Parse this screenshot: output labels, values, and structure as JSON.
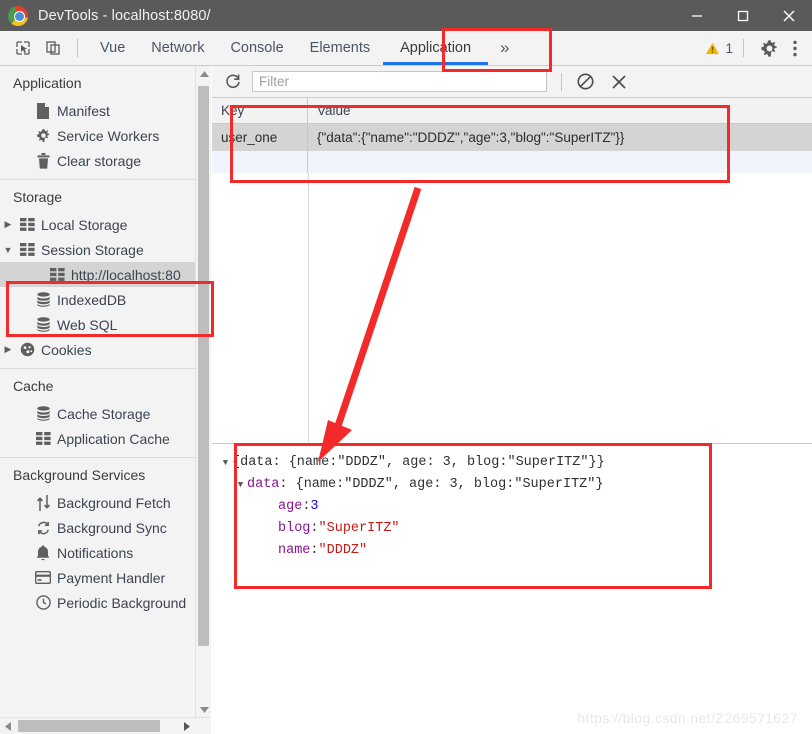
{
  "window": {
    "title": "DevTools - localhost:8080/",
    "logo_icon": "chrome-logo-icon",
    "minimize_label": "minimize-icon",
    "maximize_label": "maximize-icon",
    "close_label": "close-icon"
  },
  "tabbar": {
    "inspect_icon": "inspect-element-icon",
    "device_icon": "device-toolbar-icon",
    "tabs": [
      {
        "label": "Vue",
        "active": false
      },
      {
        "label": "Network",
        "active": false
      },
      {
        "label": "Console",
        "active": false
      },
      {
        "label": "Elements",
        "active": false
      },
      {
        "label": "Application",
        "active": true
      }
    ],
    "more_label": "»",
    "warning_icon": "warning-triangle-icon",
    "warning_count": "1",
    "settings_icon": "gear-icon",
    "menu_icon": "kebab-menu-icon"
  },
  "sidebar": {
    "sections": [
      {
        "title": "Application",
        "items": [
          {
            "label": "Manifest",
            "icon": "document-icon",
            "twisty": "",
            "indent": 1,
            "selected": false
          },
          {
            "label": "Service Workers",
            "icon": "gear-icon",
            "twisty": "",
            "indent": 1,
            "selected": false
          },
          {
            "label": "Clear storage",
            "icon": "trash-icon",
            "twisty": "",
            "indent": 1,
            "selected": false
          }
        ]
      },
      {
        "title": "Storage",
        "items": [
          {
            "label": "Local Storage",
            "icon": "table-grid-icon",
            "twisty": "▶",
            "indent": 0,
            "selected": false
          },
          {
            "label": "Session Storage",
            "icon": "table-grid-icon",
            "twisty": "▼",
            "indent": 0,
            "selected": false
          },
          {
            "label": "http://localhost:80",
            "icon": "table-grid-icon",
            "twisty": "",
            "indent": 2,
            "selected": true
          },
          {
            "label": "IndexedDB",
            "icon": "database-icon",
            "twisty": "",
            "indent": 1,
            "selected": false
          },
          {
            "label": "Web SQL",
            "icon": "database-icon",
            "twisty": "",
            "indent": 1,
            "selected": false
          },
          {
            "label": "Cookies",
            "icon": "cookie-icon",
            "twisty": "▶",
            "indent": 0,
            "selected": false
          }
        ]
      },
      {
        "title": "Cache",
        "items": [
          {
            "label": "Cache Storage",
            "icon": "database-icon",
            "twisty": "",
            "indent": 1,
            "selected": false
          },
          {
            "label": "Application Cache",
            "icon": "table-grid-icon",
            "twisty": "",
            "indent": 1,
            "selected": false
          }
        ]
      },
      {
        "title": "Background Services",
        "items": [
          {
            "label": "Background Fetch",
            "icon": "updown-arrows-icon",
            "twisty": "",
            "indent": 1,
            "selected": false
          },
          {
            "label": "Background Sync",
            "icon": "sync-icon",
            "twisty": "",
            "indent": 1,
            "selected": false
          },
          {
            "label": "Notifications",
            "icon": "bell-icon",
            "twisty": "",
            "indent": 1,
            "selected": false
          },
          {
            "label": "Payment Handler",
            "icon": "credit-card-icon",
            "twisty": "",
            "indent": 1,
            "selected": false
          },
          {
            "label": "Periodic Background",
            "icon": "clock-icon",
            "twisty": "",
            "indent": 1,
            "selected": false
          }
        ]
      }
    ],
    "scroll_up_icon": "scroll-up-arrow-icon",
    "scroll_down_icon": "scroll-down-arrow-icon",
    "scroll_left_icon": "scroll-left-arrow-icon",
    "scroll_right_icon": "scroll-right-arrow-icon"
  },
  "main": {
    "toolbar": {
      "refresh_icon": "refresh-icon",
      "filter_placeholder": "Filter",
      "filter_value": "",
      "clear_icon": "clear-all-icon",
      "delete_icon": "delete-selected-icon"
    },
    "table": {
      "columns": [
        "Key",
        "Value"
      ],
      "rows": [
        {
          "key": "user_one",
          "value": "{\"data\":{\"name\":\"DDDZ\",\"age\":3,\"blog\":\"SuperITZ\"}}",
          "selected": true
        }
      ]
    },
    "preview": {
      "lines": [
        {
          "indent": 0,
          "twisty": "▼",
          "tokens": [
            {
              "text": "{data: {name: ",
              "type": "plain"
            },
            {
              "text": "\"DDDZ\"",
              "type": "plain"
            },
            {
              "text": ", age: 3, blog: ",
              "type": "plain"
            },
            {
              "text": "\"SuperITZ\"",
              "type": "plain"
            },
            {
              "text": "}}",
              "type": "plain"
            }
          ]
        },
        {
          "indent": 1,
          "twisty": "▼",
          "tokens": [
            {
              "text": "data",
              "type": "prop"
            },
            {
              "text": ": {name: ",
              "type": "plain"
            },
            {
              "text": "\"DDDZ\"",
              "type": "plain"
            },
            {
              "text": ", age: 3, blog: ",
              "type": "plain"
            },
            {
              "text": "\"SuperITZ\"",
              "type": "plain"
            },
            {
              "text": "}",
              "type": "plain"
            }
          ]
        },
        {
          "indent": 2,
          "twisty": "",
          "tokens": [
            {
              "text": "age",
              "type": "prop"
            },
            {
              "text": ": ",
              "type": "plain"
            },
            {
              "text": "3",
              "type": "num"
            }
          ]
        },
        {
          "indent": 2,
          "twisty": "",
          "tokens": [
            {
              "text": "blog",
              "type": "prop"
            },
            {
              "text": ": ",
              "type": "plain"
            },
            {
              "text": "\"SuperITZ\"",
              "type": "str"
            }
          ]
        },
        {
          "indent": 2,
          "twisty": "",
          "tokens": [
            {
              "text": "name",
              "type": "prop"
            },
            {
              "text": ": ",
              "type": "plain"
            },
            {
              "text": "\"DDDZ\"",
              "type": "str"
            }
          ]
        }
      ]
    }
  },
  "watermark": "https://blog.csdn.net/Z269571627",
  "colors": {
    "accent_tab": "#1a73e8",
    "annotation": "#f42a2a",
    "warning": "#f5b400",
    "titlebar": "#5a5a5a",
    "selection": "#d4d4d4"
  }
}
